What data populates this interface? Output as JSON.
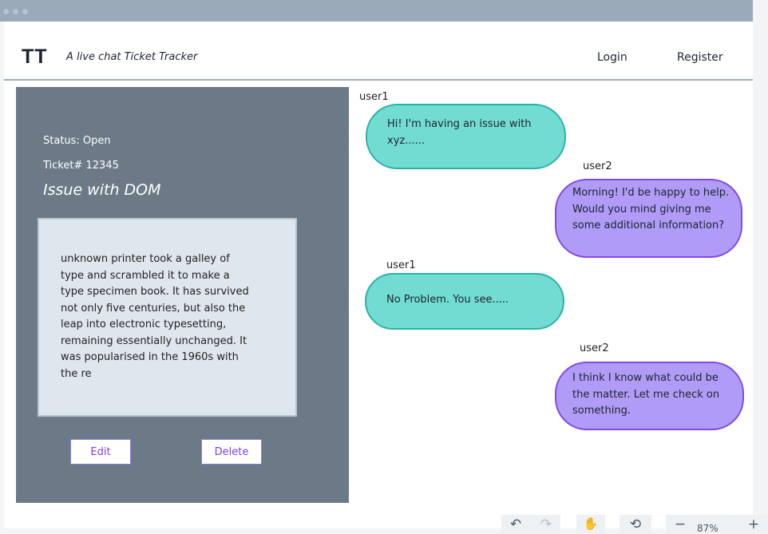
{
  "app": {
    "logo": "TT",
    "tagline": "A live chat Ticket Tracker"
  },
  "nav": {
    "login": "Login",
    "register": "Register"
  },
  "ticket": {
    "status": "Status: Open",
    "number": "Ticket# 12345",
    "title": "Issue with DOM",
    "description": " unknown printer took a galley of type and scrambled it to make a type specimen book. It has survived not only five centuries, but also the leap into electronic typesetting, remaining essentially unchanged. It was popularised in the 1960s with the re",
    "edit_label": "Edit",
    "delete_label": "Delete"
  },
  "chat": {
    "messages": [
      {
        "user": "user1",
        "text": "Hi! I'm having an issue with xyz......"
      },
      {
        "user": "user2",
        "text": "Morning! I'd be happy to help. Would you mind giving me some additional information?"
      },
      {
        "user": "user1",
        "text": "No Problem. You see....."
      },
      {
        "user": "user2",
        "text": "I think I know what could be the matter. Let me check on something."
      }
    ]
  },
  "toolbar": {
    "undo_icon": "↶",
    "redo_icon": "↷",
    "hand_icon": "✋",
    "history_icon": "⟲",
    "zoom_out": "−",
    "zoom_level": "87%",
    "zoom_in": "+"
  },
  "colors": {
    "panel": "#6c7a87",
    "teal_bubble": "#72dcd3",
    "purple_bubble": "#b09cf7",
    "accent": "#7a3df0"
  }
}
